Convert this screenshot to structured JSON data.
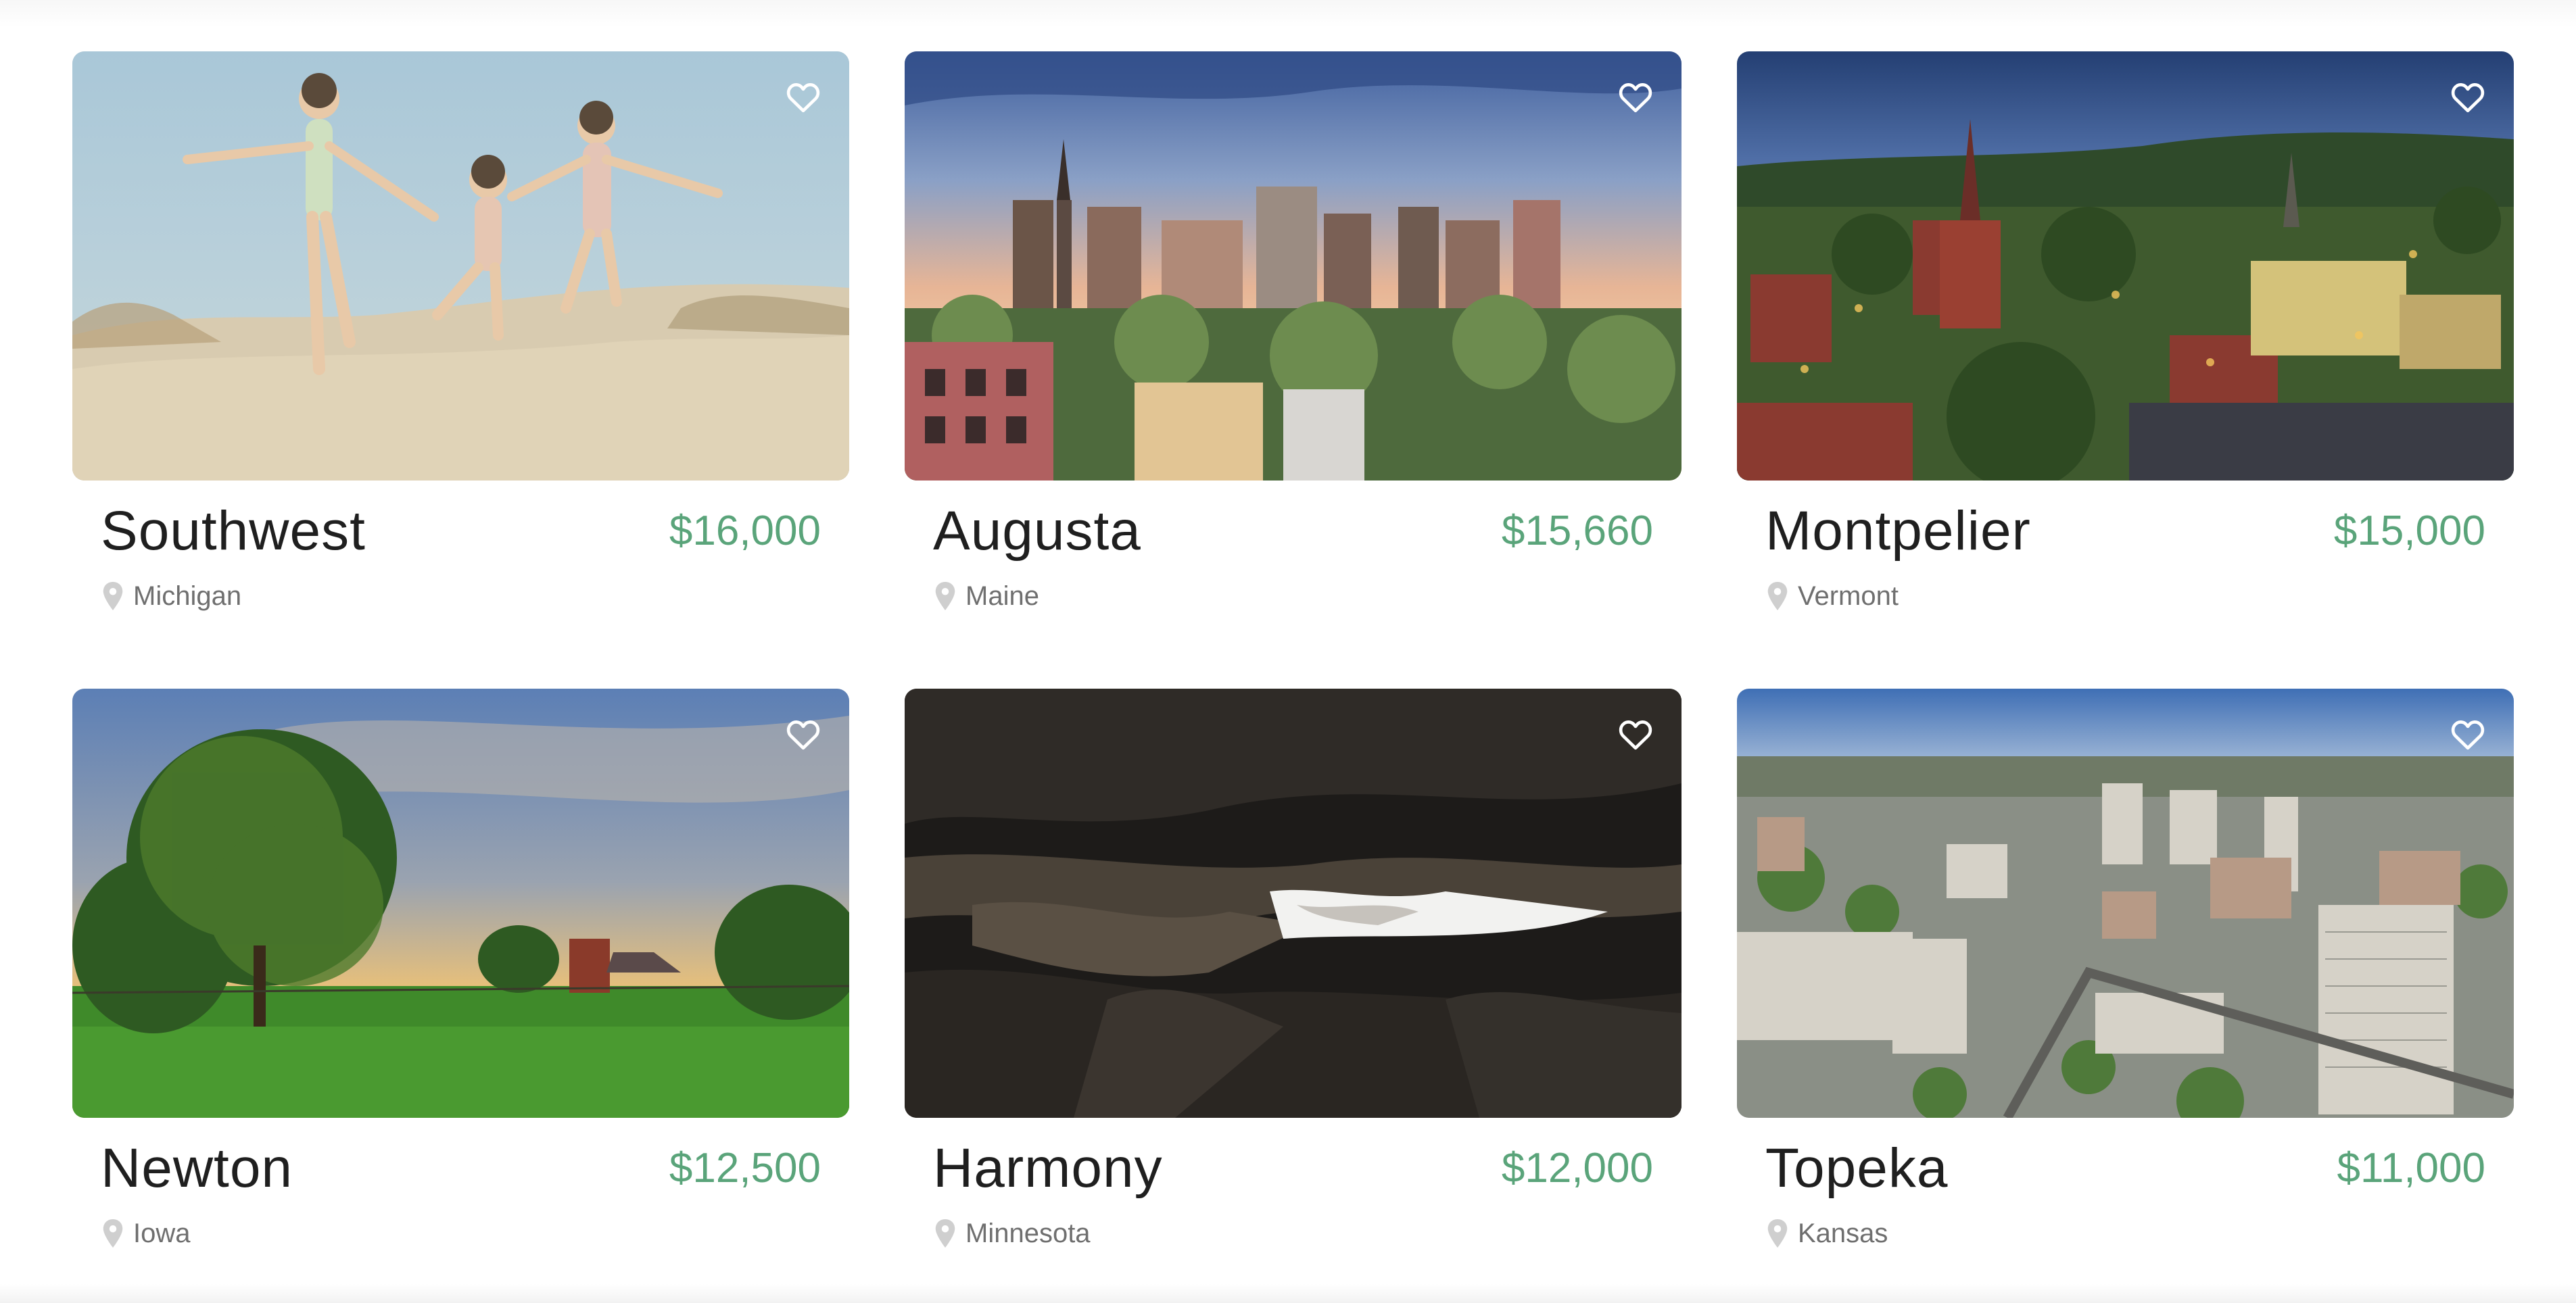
{
  "listings": [
    {
      "title": "Southwest",
      "price": "$16,000",
      "location": "Michigan",
      "scene": "beach"
    },
    {
      "title": "Augusta",
      "price": "$15,660",
      "location": "Maine",
      "scene": "city-dusk"
    },
    {
      "title": "Montpelier",
      "price": "$15,000",
      "location": "Vermont",
      "scene": "town-night"
    },
    {
      "title": "Newton",
      "price": "$12,500",
      "location": "Iowa",
      "scene": "farm-field"
    },
    {
      "title": "Harmony",
      "price": "$12,000",
      "location": "Minnesota",
      "scene": "cave"
    },
    {
      "title": "Topeka",
      "price": "$11,000",
      "location": "Kansas",
      "scene": "city-aerial"
    }
  ],
  "icons": {
    "favorite": "heart-outline-icon",
    "location": "map-pin-icon"
  },
  "colors": {
    "price": "#5aa47a",
    "title": "#1f1f1f",
    "location": "#6f6f6f"
  }
}
